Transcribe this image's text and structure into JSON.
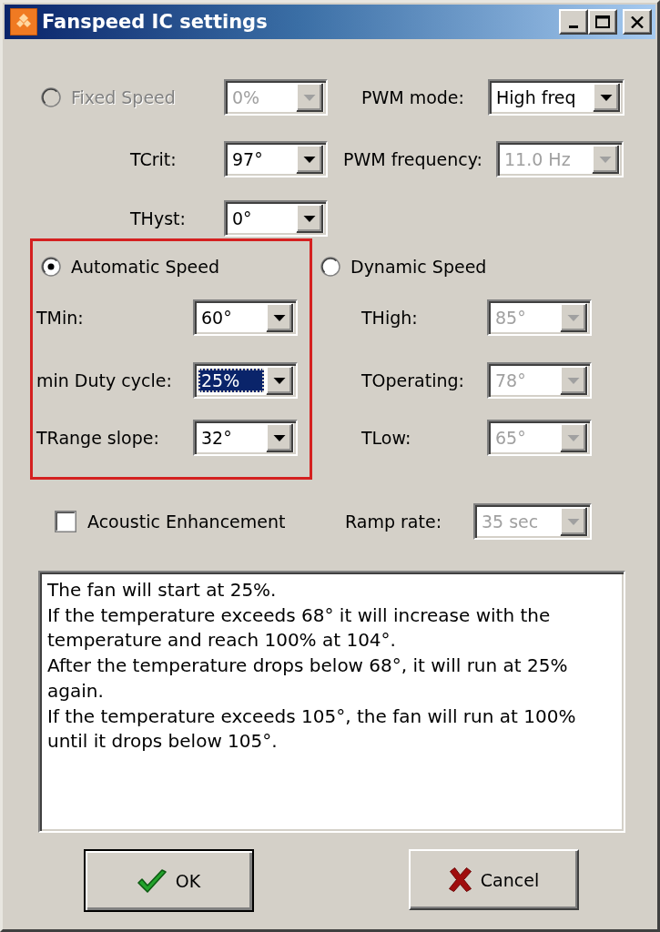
{
  "window": {
    "title": "Fanspeed IC settings"
  },
  "title_buttons": [
    {
      "kind": "minimize"
    },
    {
      "kind": "maximize"
    },
    {
      "kind": "close"
    }
  ],
  "speed_modes": [
    {
      "label": "Fixed Speed",
      "selected": false,
      "disabled": true
    },
    {
      "label": "Automatic Speed",
      "selected": true,
      "disabled": false
    },
    {
      "label": "Dynamic Speed",
      "selected": false,
      "disabled": false
    }
  ],
  "fixed_speed": {
    "value": "0%",
    "disabled": true
  },
  "pwm_mode": {
    "label": "PWM mode:",
    "value": "High freq",
    "disabled": false
  },
  "tcrit": {
    "label": "TCrit:",
    "value": "97°",
    "disabled": false
  },
  "pwm_frequency": {
    "label": "PWM frequency:",
    "value": "11.0 Hz",
    "disabled": true
  },
  "thyst": {
    "label": "THyst:",
    "value": "0°",
    "disabled": false
  },
  "automatic_fields": [
    {
      "label": "TMin:",
      "value": "60°",
      "disabled": false,
      "focused": false
    },
    {
      "label": "min Duty cycle:",
      "value": "25%",
      "disabled": false,
      "focused": true
    },
    {
      "label": "TRange slope:",
      "value": "32°",
      "disabled": false,
      "focused": false
    }
  ],
  "dynamic_fields": [
    {
      "label": "THigh:",
      "value": "85°",
      "disabled": true
    },
    {
      "label": "TOperating:",
      "value": "78°",
      "disabled": true
    },
    {
      "label": "TLow:",
      "value": "65°",
      "disabled": true
    }
  ],
  "acoustic_enhancement": {
    "label": "Acoustic Enhancement",
    "checked": false
  },
  "ramp_rate": {
    "label": "Ramp rate:",
    "value": "35 sec",
    "disabled": true
  },
  "description": [
    "The fan will start at 25%.",
    "If the temperature exceeds 68° it will increase with the temperature and reach 100% at 104°.",
    "After the temperature drops below 68°, it will run at 25% again.",
    "If the temperature exceeds 105°, the fan will run at 100% until it drops below 105°."
  ],
  "buttons": [
    {
      "label": "OK",
      "kind": "ok",
      "default": true
    },
    {
      "label": "Cancel",
      "kind": "cancel",
      "default": false
    }
  ]
}
